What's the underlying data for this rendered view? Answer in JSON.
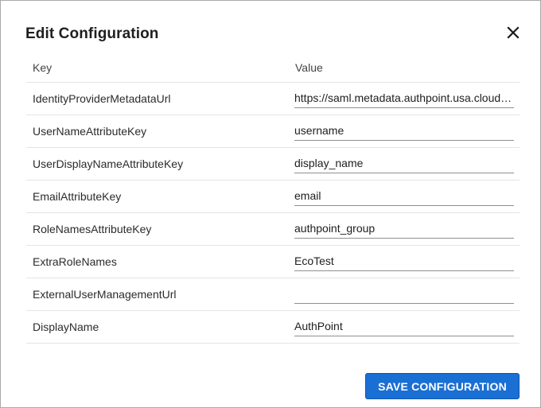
{
  "dialog": {
    "title": "Edit Configuration",
    "close_icon": "close-icon"
  },
  "table": {
    "headers": {
      "key": "Key",
      "value": "Value"
    },
    "rows": [
      {
        "key": "IdentityProviderMetadataUrl",
        "value": "https://saml.metadata.authpoint.usa.cloud.watchguard.com"
      },
      {
        "key": "UserNameAttributeKey",
        "value": "username"
      },
      {
        "key": "UserDisplayNameAttributeKey",
        "value": "display_name"
      },
      {
        "key": "EmailAttributeKey",
        "value": "email"
      },
      {
        "key": "RoleNamesAttributeKey",
        "value": "authpoint_group"
      },
      {
        "key": "ExtraRoleNames",
        "value": "EcoTest"
      },
      {
        "key": "ExternalUserManagementUrl",
        "value": ""
      },
      {
        "key": "DisplayName",
        "value": "AuthPoint"
      }
    ]
  },
  "actions": {
    "save_label": "SAVE CONFIGURATION"
  },
  "colors": {
    "primary_button": "#1a6fd4",
    "row_divider": "#e4e4e4"
  }
}
